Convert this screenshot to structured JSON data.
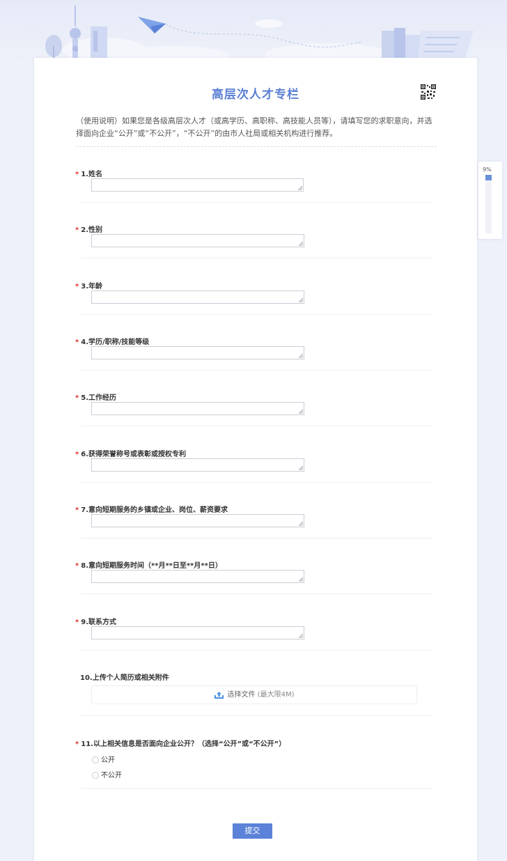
{
  "form": {
    "title": "高层次人才专栏",
    "description": "（使用说明）如果您是各级高层次人才（或高学历、高职称、高技能人员等），请填写您的求职意向，并选择面向企业“公开”或“不公开”，“不公开”的由市人社局或相关机构进行推荐。",
    "required_mark": "*",
    "questions": [
      {
        "label": "1.姓名"
      },
      {
        "label": "2.性别"
      },
      {
        "label": "3.年龄"
      },
      {
        "label": "4.学历/职称/技能等级"
      },
      {
        "label": "5.工作经历"
      },
      {
        "label": "6.获得荣誉称号或表彰或授权专利"
      },
      {
        "label": "7.意向短期服务的乡镇或企业、岗位、薪资要求"
      },
      {
        "label": "8.意向短期服务时间（**月**日至**月**日）"
      },
      {
        "label": "9.联系方式"
      }
    ],
    "upload": {
      "label": "10.上传个人简历或相关附件",
      "button": "选择文件",
      "limit": "(最大限4M)"
    },
    "choice": {
      "label": "11.以上相关信息是否面向企业公开？（选择“公开”或“不公开”）",
      "options": [
        "公开",
        "不公开"
      ]
    },
    "submit_label": "提交"
  },
  "progress": {
    "text": "9%",
    "value": 0.09
  },
  "colors": {
    "accent": "#5b82d8",
    "title": "#5b7fd4",
    "required": "#e0342f"
  }
}
